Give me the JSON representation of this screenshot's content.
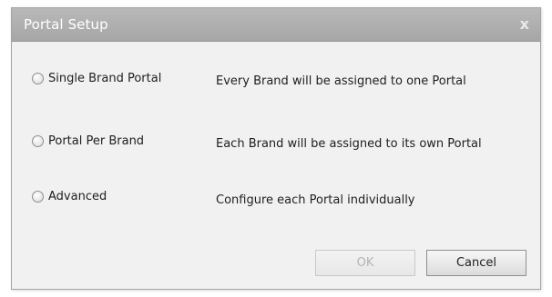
{
  "dialog": {
    "title": "Portal Setup",
    "close_label": "x"
  },
  "options": [
    {
      "label": "Single Brand Portal",
      "description": "Every Brand will be assigned to one Portal",
      "selected": false
    },
    {
      "label": "Portal Per Brand",
      "description": "Each Brand will be assigned to its own Portal",
      "selected": false
    },
    {
      "label": "Advanced",
      "description": "Configure each Portal individually",
      "selected": false
    }
  ],
  "buttons": {
    "ok_label": "OK",
    "ok_enabled": false,
    "cancel_label": "Cancel"
  }
}
